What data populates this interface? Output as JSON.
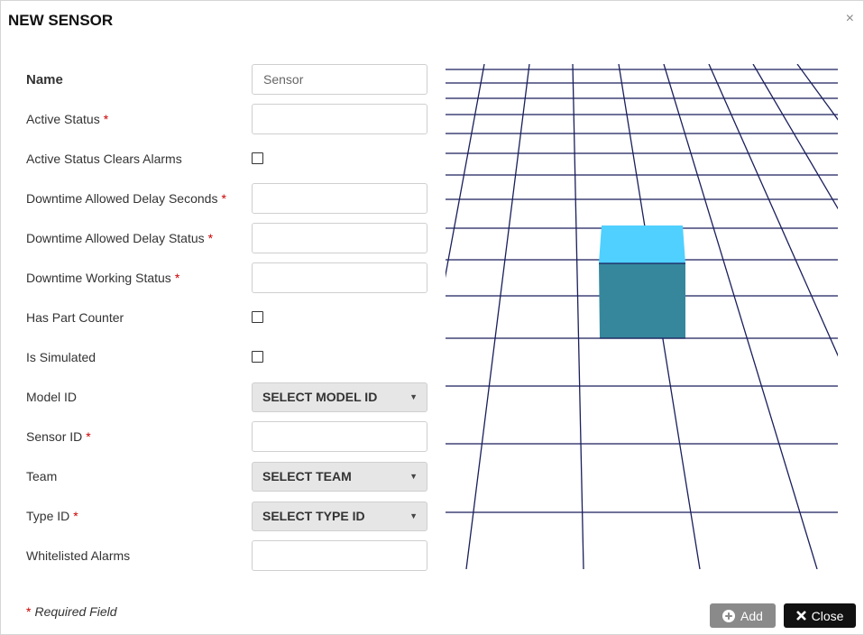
{
  "dialog": {
    "title": "NEW SENSOR",
    "close_glyph": "×"
  },
  "fields": [
    {
      "label": "Name",
      "type": "text",
      "placeholder": "Sensor",
      "value": "",
      "required": false
    },
    {
      "label": "Active Status",
      "type": "text",
      "value": "",
      "required": true
    },
    {
      "label": "Active Status Clears Alarms",
      "type": "checkbox",
      "checked": false,
      "required": false
    },
    {
      "label": "Downtime Allowed Delay Seconds",
      "type": "text",
      "value": "",
      "required": true
    },
    {
      "label": "Downtime Allowed Delay Status",
      "type": "text",
      "value": "",
      "required": true
    },
    {
      "label": "Downtime Working Status",
      "type": "text",
      "value": "",
      "required": true
    },
    {
      "label": "Has Part Counter",
      "type": "checkbox",
      "checked": false,
      "required": false
    },
    {
      "label": "Is Simulated",
      "type": "checkbox",
      "checked": false,
      "required": false
    },
    {
      "label": "Model ID",
      "type": "select",
      "selected": "SELECT MODEL ID",
      "required": false
    },
    {
      "label": "Sensor ID",
      "type": "text",
      "value": "",
      "required": true
    },
    {
      "label": "Team",
      "type": "select",
      "selected": "SELECT TEAM",
      "required": false
    },
    {
      "label": "Type ID",
      "type": "select",
      "selected": "SELECT TYPE ID",
      "required": true
    },
    {
      "label": "Whitelisted Alarms",
      "type": "text",
      "value": "",
      "required": false
    }
  ],
  "required_marker": "*",
  "footer": {
    "required_note": "Required Field",
    "add_label": "Add",
    "close_label": "Close"
  },
  "viewport": {
    "grid_color": "#1a1f5c",
    "cube_top_color": "#4fd0ff",
    "cube_front_color": "#36879c"
  },
  "icons": {
    "add": "plus-circle-icon",
    "close": "times-icon",
    "select_arrow": "caret-down-icon"
  }
}
